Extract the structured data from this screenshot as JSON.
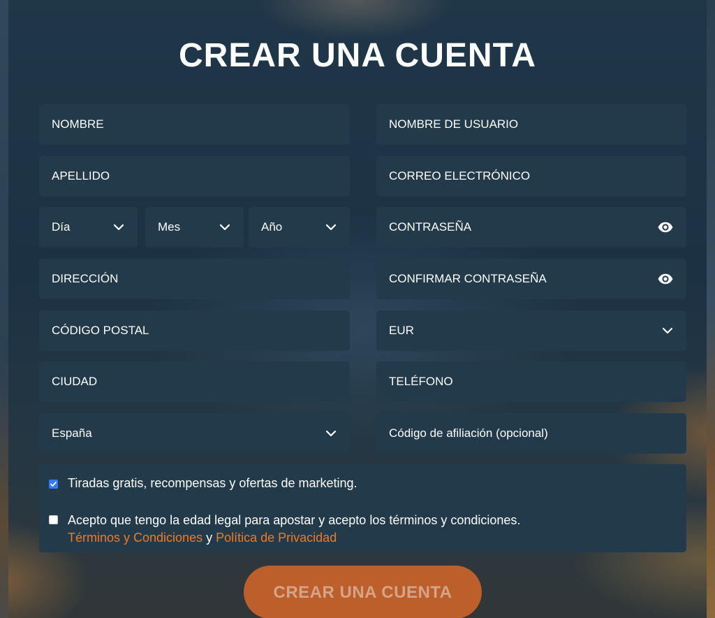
{
  "form": {
    "title": "CREAR UNA CUENTA",
    "left": {
      "first_name": "NOMBRE",
      "last_name": "APELLIDO",
      "day": "Día",
      "month": "Mes",
      "year": "Año",
      "address": "DIRECCIÓN",
      "postal_code": "CÓDIGO POSTAL",
      "city": "CIUDAD",
      "country": "España"
    },
    "right": {
      "username": "NOMBRE DE USUARIO",
      "email": "CORREO ELECTRÓNICO",
      "password": "CONTRASEÑA",
      "confirm_password": "CONFIRMAR CONTRASEÑA",
      "currency": "EUR",
      "phone": "TELÉFONO",
      "affiliate_code": "Código de afiliación (opcional)"
    },
    "consent": {
      "marketing_label": "Tiradas gratis, recompensas y ofertas de marketing.",
      "marketing_checked": true,
      "legal_label": "Acepto que tengo la edad legal para apostar y acepto los términos y condiciones.",
      "legal_checked": false,
      "terms_link": "Términos y Condiciones",
      "conjunction": "y",
      "privacy_link": "Política de Privacidad"
    },
    "submit_label": "CREAR UNA CUENTA"
  },
  "icons": {
    "select": "chevron-down-icon",
    "password_toggle": "eye-icon",
    "checked": "checkmark-icon"
  },
  "colors": {
    "field_bg": "#233a4a",
    "link": "#f07a22",
    "checkbox_on": "#2f7dfa",
    "submit_bg": "#bd5f2a",
    "submit_text": "#d4a58a"
  }
}
